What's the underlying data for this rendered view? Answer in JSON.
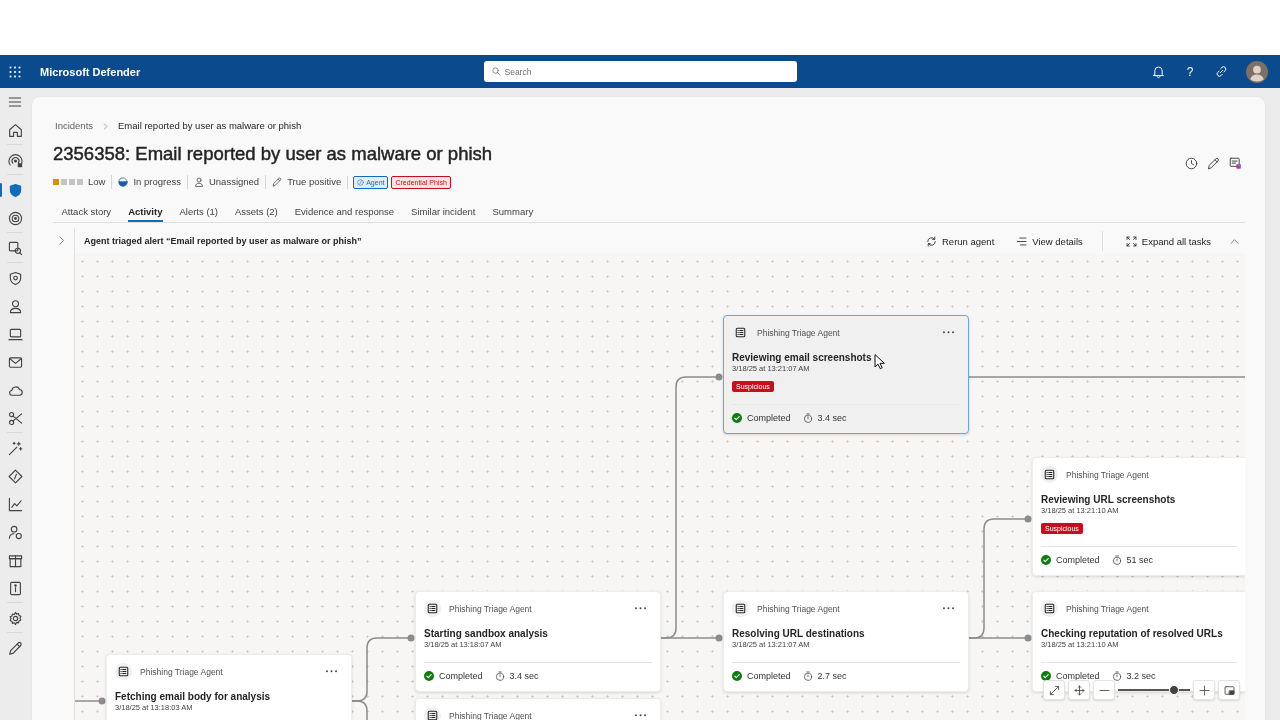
{
  "app_bar": {
    "title": "Microsoft Defender",
    "search": {
      "placeholder": "Search"
    },
    "help": "?"
  },
  "nav": {
    "groups": [
      {
        "items": [
          {
            "selected": false
          }
        ]
      },
      {
        "items": [
          {
            "selected": false
          }
        ]
      },
      {
        "items": [
          {
            "selected": true
          },
          {
            "selected": false
          }
        ]
      },
      {
        "items": [
          {
            "selected": false
          }
        ]
      },
      {
        "items": [
          {
            "selected": false
          },
          {
            "selected": false
          },
          {
            "selected": false
          },
          {
            "selected": false
          },
          {
            "selected": false
          },
          {
            "selected": false
          }
        ]
      },
      {
        "items": [
          {
            "selected": false
          },
          {
            "selected": false
          },
          {
            "selected": false
          },
          {
            "selected": false
          },
          {
            "selected": false
          },
          {
            "selected": false
          }
        ]
      },
      {
        "items": [
          {
            "selected": false
          }
        ]
      },
      {
        "items": [
          {
            "selected": false
          }
        ]
      }
    ]
  },
  "breadcrumb": [
    "Incidents",
    "Email reported by user as malware or phish"
  ],
  "incident": {
    "title": "2356358: Email reported by user as malware or phish",
    "severity": {
      "label": "Low",
      "level": 0.25
    },
    "properties": [
      {
        "kind": "status",
        "label": "In progress"
      },
      {
        "kind": "assignee",
        "label": "Unassigned"
      },
      {
        "kind": "classification",
        "label": "True positive"
      }
    ],
    "tags": [
      {
        "kind": "agent",
        "label": "Agent",
        "color": "#0f6cbd"
      },
      {
        "kind": "category",
        "label": "Credential Phish",
        "color": "#c50f1f"
      }
    ]
  },
  "tabs": [
    {
      "label": "Attack story",
      "selected": false
    },
    {
      "label": "Activity",
      "selected": true
    },
    {
      "label": "Alerts (1)",
      "selected": false
    },
    {
      "label": "Assets (2)",
      "selected": false
    },
    {
      "label": "Evidence and response",
      "selected": false
    },
    {
      "label": "Similar incident",
      "selected": false
    },
    {
      "label": "Summary",
      "selected": false
    }
  ],
  "agent_run": {
    "title": "Agent triaged alert “Email reported by user as malware or phish”",
    "actions": [
      {
        "kind": "rerun",
        "label": "Rerun agent"
      },
      {
        "kind": "details",
        "label": "View details"
      },
      {
        "kind": "expand",
        "label": "Expand all tasks"
      }
    ]
  },
  "flow": {
    "nodes": [
      {
        "agent": "Phishing Triage Agent",
        "title": "Fetching email body for analysis",
        "time": "3/18/25 at 13:18:03 AM",
        "selected": false,
        "menu": true,
        "enters_from_left": true,
        "children": [
          {
            "agent": "Phishing Triage Agent",
            "title": "Starting sandbox analysis",
            "time": "3/18/25 at 13:18:07 AM",
            "status": "Completed",
            "duration": "3.4 sec",
            "selected": false,
            "menu": true,
            "children": [
              {
                "agent": "Phishing Triage Agent",
                "title": "Reviewing email screenshots",
                "time": "3/18/25 at 13:21:07 AM",
                "badge": "Suspicious",
                "status": "Completed",
                "duration": "3.4 sec",
                "selected": true,
                "menu": true,
                "exits_right": true
              },
              {
                "agent": "Phishing Triage Agent",
                "title": "Resolving URL destinations",
                "time": "3/18/25 at 13:21:07 AM",
                "status": "Completed",
                "duration": "2.7 sec",
                "selected": false,
                "menu": true,
                "children": [
                  {
                    "agent": "Phishing Triage Agent",
                    "title": "Reviewing URL screenshots",
                    "time": "3/18/25 at 13:21:10 AM",
                    "badge": "Suspicious",
                    "status": "Completed",
                    "duration": "51 sec",
                    "selected": false
                  },
                  {
                    "agent": "Phishing Triage Agent",
                    "title": "Checking reputation of resolved URLs",
                    "time": "3/18/25 at 13:21:10 AM",
                    "status": "Completed",
                    "duration": "3.2 sec",
                    "selected": false
                  }
                ]
              }
            ]
          },
          {
            "agent": "Phishing Triage Agent",
            "selected": false,
            "menu": true
          }
        ]
      }
    ],
    "zoom_slider": {
      "level": 0.78
    }
  }
}
